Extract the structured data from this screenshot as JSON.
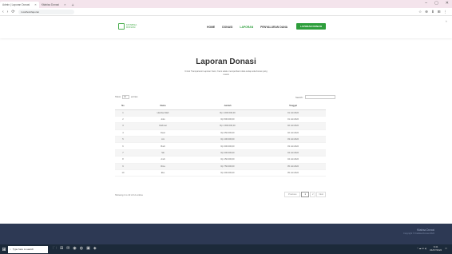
{
  "browser": {
    "tabs": [
      {
        "label": "Admin | Laporan Donasi"
      },
      {
        "label": "Kitabisa Donasi"
      }
    ],
    "new_tab": "+",
    "window_controls": [
      "–",
      "▢",
      "✕"
    ],
    "url": "localhost/laporan",
    "nav_icons": [
      "‹",
      "›",
      "⟳"
    ],
    "ext_icons": [
      "☆",
      "⊕",
      "⬇",
      "⊞",
      "⋮"
    ]
  },
  "site": {
    "logo_text_1": "KITABISA",
    "logo_text_2": "DONASI",
    "nav": [
      {
        "label": "HOME",
        "active": false
      },
      {
        "label": "DONASI",
        "active": false
      },
      {
        "label": "LAPORAN",
        "active": true
      },
      {
        "label": "PENYALURAN DANA",
        "active": false
      }
    ],
    "cta_label": "LAPORAN DONASI",
    "scroll_up": "˄"
  },
  "main": {
    "title": "Laporan Donasi",
    "subtitle": "Untuk Transparansi Laporan Kami, Kami selalu memperbarui data setiap ada donasi yang masuk",
    "show_label": "Show",
    "show_value": "10",
    "entries_label": "entries",
    "search_label": "Search:",
    "columns": [
      "No",
      "Nama",
      "Jumlah",
      "Tanggal"
    ],
    "rows": [
      [
        "1",
        "Hamba Allah",
        "Rp 1.000.000,00",
        "01 Juli 2022"
      ],
      [
        "2",
        "Joko",
        "Rp 500.000,00",
        "01 Juli 2022"
      ],
      [
        "3",
        "Rahmat",
        "Rp 1.500.000,00",
        "02 Juli 2022"
      ],
      [
        "4",
        "Dewi",
        "Rp 250.000,00",
        "02 Juli 2022"
      ],
      [
        "5",
        "Ani",
        "Rp 100.000,00",
        "03 Juli 2022"
      ],
      [
        "6",
        "Budi",
        "Rp 300.000,00",
        "03 Juli 2022"
      ],
      [
        "7",
        "Siti",
        "Rp 200.000,00",
        "04 Juli 2022"
      ],
      [
        "8",
        "Andi",
        "Rp 150.000,00",
        "04 Juli 2022"
      ],
      [
        "9",
        "Rina",
        "Rp 750.000,00",
        "05 Juli 2022"
      ],
      [
        "10",
        "Eko",
        "Rp 400.000,00",
        "05 Juli 2022"
      ]
    ],
    "info": "Showing 1 to 10 of 12 entries",
    "pager": {
      "previous": "Previous",
      "page1": "1",
      "page2": "2",
      "next": "Next"
    }
  },
  "footer": {
    "title": "Kitabisa Donasi",
    "copy": "Copyright © Kitabisa Donasi 2022"
  },
  "taskbar": {
    "start_icon": "⊞",
    "search_placeholder": "Type here to search",
    "apps": [
      "🗀",
      "⊞",
      "✉",
      "◉",
      "◍",
      "▣",
      "◈"
    ],
    "tray_icons": "^ ☁ ⊡ ◂)",
    "time": "9:41",
    "date": "04/07/2022"
  }
}
